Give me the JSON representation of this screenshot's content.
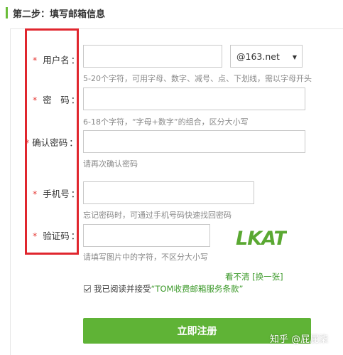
{
  "step": {
    "title": "第二步：填写邮箱信息"
  },
  "form": {
    "username": {
      "label": "用户名",
      "hint": "5-20个字符，可用字母、数字、减号、点、下划线，需以字母开头"
    },
    "domain": {
      "selected": "@163.net"
    },
    "password": {
      "label": "密　码",
      "hint": "6-18个字符，“字母+数字”的组合，区分大小写"
    },
    "confirm": {
      "label": "确认密码",
      "hint": "请再次确认密码"
    },
    "phone": {
      "label": "手机号",
      "hint": "忘记密码时，可通过手机号码快速找回密码"
    },
    "captcha": {
      "label": "验证码",
      "hint": "请填写图片中的字符，不区分大小写",
      "image_text": "LKAT"
    },
    "required_mark": "*",
    "colon": "："
  },
  "refresh": {
    "prefix": "看不清",
    "link": "[换一张]"
  },
  "agreement": {
    "prefix": "我已阅读并接受",
    "link": "“TOM收费邮箱服务条款”",
    "checked": true
  },
  "submit": {
    "label": "立即注册"
  },
  "watermark": {
    "text": "知乎 @屁屁柒"
  },
  "colors": {
    "accent": "#5fb336",
    "link": "#3d9a2b",
    "required": "#e53935",
    "highlight_box": "#e0262e"
  }
}
